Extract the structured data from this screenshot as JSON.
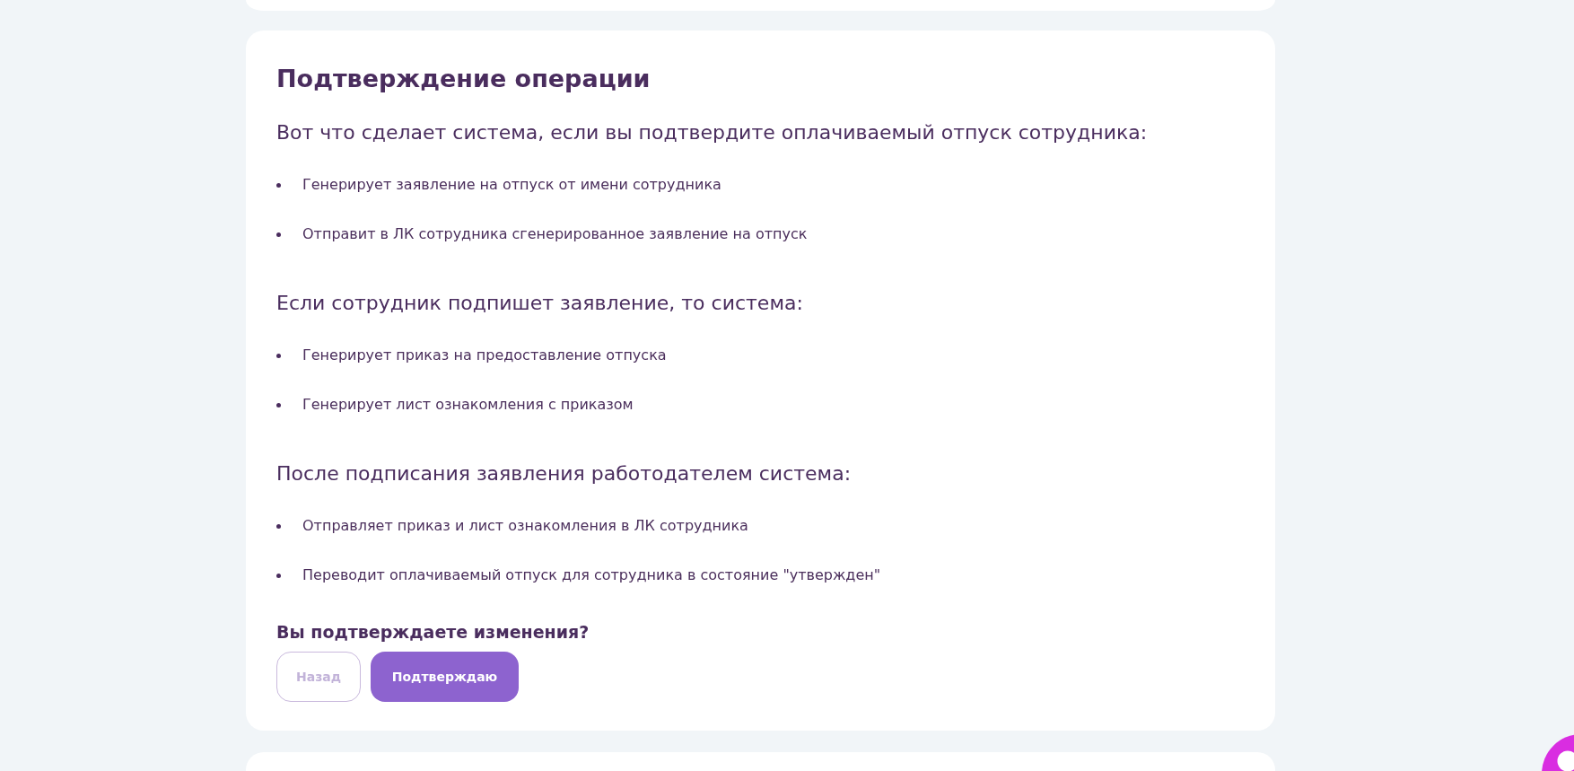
{
  "confirmation": {
    "title": "Подтверждение операции",
    "sections": [
      {
        "heading": "Вот что сделает система, если вы подтвердите оплачиваемый отпуск сотрудника:",
        "items": [
          "Генерирует заявление на отпуск от имени сотрудника",
          "Отправит в ЛК сотрудника сгенерированное заявление на отпуск"
        ]
      },
      {
        "heading": "Если сотрудник подпишет заявление, то система:",
        "items": [
          "Генерирует приказ на предоставление отпуска",
          "Генерирует лист ознакомления с приказом"
        ]
      },
      {
        "heading": "После подписания заявления работодателем система:",
        "items": [
          "Отправляет приказ и лист ознакомления в ЛК сотрудника",
          "Переводит оплачиваемый отпуск для сотрудника в состояние \"утвержден\""
        ]
      }
    ],
    "question": "Вы подтверждаете изменения?",
    "buttons": [
      {
        "label": "Назад",
        "kind": "secondary"
      },
      {
        "label": "Подтверждаю",
        "kind": "primary"
      }
    ]
  }
}
